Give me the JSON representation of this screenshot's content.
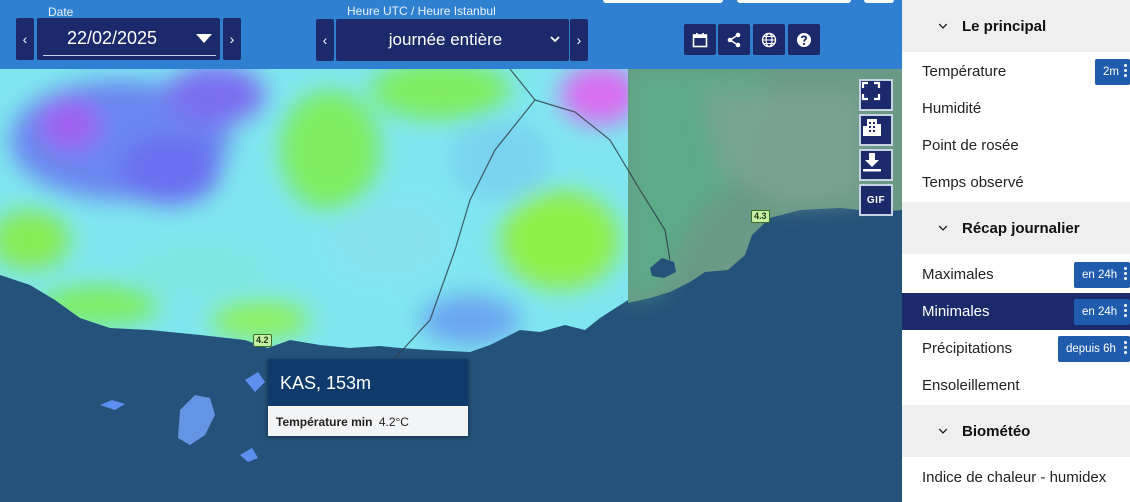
{
  "header": {
    "date_label": "Date",
    "date_value": "22/02/2025",
    "time_label": "Heure UTC / Heure Istanbul",
    "period_value": "journée entière",
    "prev_arrow": "‹",
    "next_arrow": "›",
    "tools": [
      "calendar-icon",
      "share-icon",
      "globe-icon",
      "help-icon"
    ]
  },
  "map": {
    "side_buttons": [
      "fullscreen-icon",
      "buildings-icon",
      "download-icon"
    ],
    "gif_label": "GIF",
    "road_badges": [
      "4.2",
      "4.3"
    ],
    "popup": {
      "title": "KAS, 153m",
      "key": "Température min",
      "value": "4.2°C"
    }
  },
  "sidebar": {
    "sections": [
      {
        "title": "Le principal",
        "items": [
          {
            "label": "Température",
            "badge": "2m"
          },
          {
            "label": "Humidité"
          },
          {
            "label": "Point de rosée"
          },
          {
            "label": "Temps observé"
          }
        ]
      },
      {
        "title": "Récap journalier",
        "items": [
          {
            "label": "Maximales",
            "badge": "en 24h"
          },
          {
            "label": "Minimales",
            "badge": "en 24h",
            "active": true
          },
          {
            "label": "Précipitations",
            "badge": "depuis 6h"
          },
          {
            "label": "Ensoleillement"
          }
        ]
      },
      {
        "title": "Biométéo",
        "items": [
          {
            "label": "Indice de chaleur - humidex"
          }
        ]
      }
    ]
  },
  "colors": {
    "header_blue": "#2f80d1",
    "navy": "#1c2a6b",
    "badge_blue": "#1f5cad",
    "sea": "#25527a",
    "popup_header": "#0e3b6b"
  }
}
